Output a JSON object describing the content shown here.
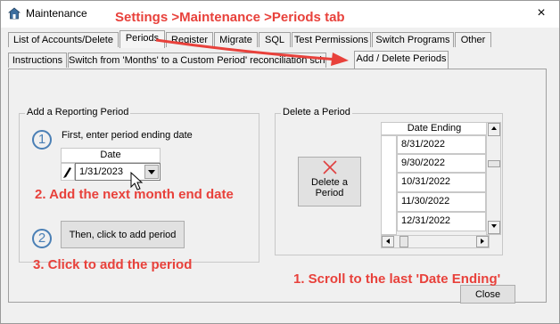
{
  "window": {
    "title": "Maintenance",
    "close_glyph": "×"
  },
  "annotations": {
    "header": "Settings >Maintenance >Periods tab",
    "step2": "2. Add the next month end date",
    "step3": "3. Click to add the period",
    "step1": "1. Scroll to the last 'Date Ending'"
  },
  "tabs_row1": [
    "List of Accounts/Delete",
    "Periods",
    "Register",
    "Migrate",
    "SQL",
    "Test Permissions",
    "Switch Programs",
    "Other"
  ],
  "tabs_row2": [
    "Instructions",
    "Switch from 'Months' to a Custom Period' reconciliation sched",
    "Add / Delete Periods"
  ],
  "add_group": {
    "label": "Add a Reporting Period",
    "step1_num": "1",
    "step1_text": "First, enter period ending date",
    "date_header": "Date",
    "date_value": "1/31/2023",
    "step2_num": "2",
    "add_button": "Then, click to add  period"
  },
  "delete_group": {
    "label": "Delete a Period",
    "delete_button": "Delete a Period",
    "grid_header": "Date Ending",
    "rows": [
      "8/31/2022",
      "9/30/2022",
      "10/31/2022",
      "11/30/2022",
      "12/31/2022"
    ]
  },
  "close_button": "Close",
  "colors": {
    "annotation": "#e8413b",
    "accent_circle": "#4a7fb5",
    "delete_x": "#e04040"
  },
  "icons": [
    "home-icon",
    "close-icon",
    "pencil-icon",
    "dropdown-arrow-icon",
    "delete-x-icon",
    "scroll-up-icon",
    "scroll-down-icon",
    "scroll-left-icon",
    "scroll-right-icon",
    "mouse-cursor-icon",
    "red-arrow-icon"
  ]
}
